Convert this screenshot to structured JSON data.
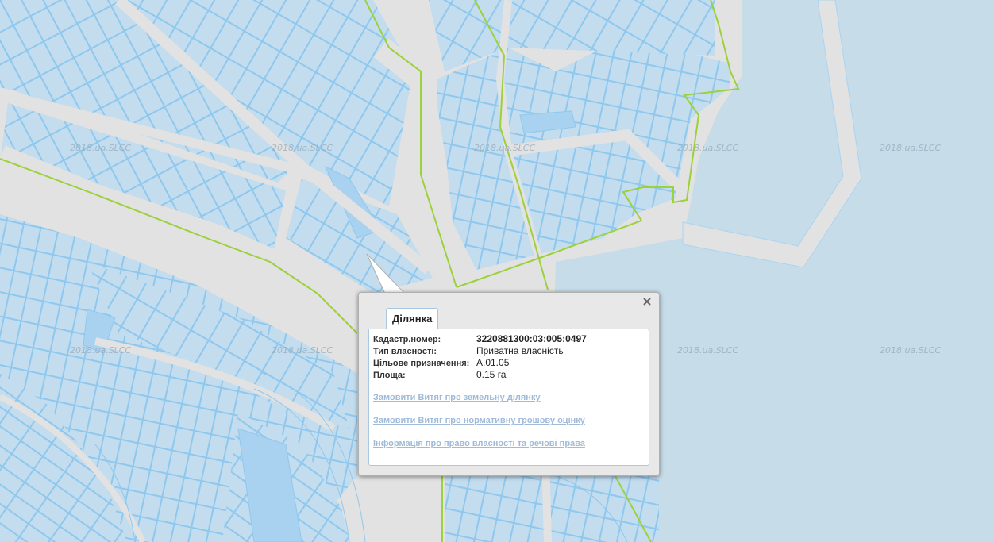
{
  "map": {
    "watermark_text": "2018.ua.SLCC",
    "colors": {
      "water": "#c6dce8",
      "land": "#e2e2e2",
      "parcel_fill": "#c3dcee",
      "parcel_fill_dark": "#a9d2f0",
      "parcel_stroke": "#8ec8ee",
      "boundary_line": "#9bd13a"
    }
  },
  "popup": {
    "close_icon": "close-icon",
    "tab_label": "Ділянка",
    "fields": [
      {
        "label": "Кадастр.номер:",
        "value": "3220881300:03:005:0497"
      },
      {
        "label": "Тип власності:",
        "value": "Приватна власність"
      },
      {
        "label": "Цільове призначення:",
        "value": "A.01.05"
      },
      {
        "label": "Площа:",
        "value": "0.15 га"
      }
    ],
    "links": [
      "Замовити Витяг про земельну ділянку",
      "Замовити Витяг про нормативну грошову оцінку",
      "Інформація про право власності та речові права"
    ]
  }
}
